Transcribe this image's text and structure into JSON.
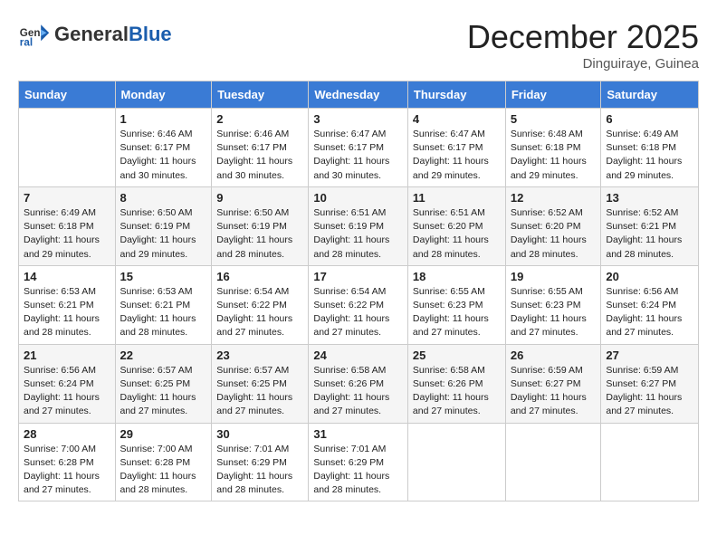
{
  "header": {
    "logo_general": "General",
    "logo_blue": "Blue",
    "month_title": "December 2025",
    "location": "Dinguiraye, Guinea"
  },
  "days_of_week": [
    "Sunday",
    "Monday",
    "Tuesday",
    "Wednesday",
    "Thursday",
    "Friday",
    "Saturday"
  ],
  "weeks": [
    [
      {
        "day": "",
        "sunrise": "",
        "sunset": "",
        "daylight": ""
      },
      {
        "day": "1",
        "sunrise": "Sunrise: 6:46 AM",
        "sunset": "Sunset: 6:17 PM",
        "daylight": "Daylight: 11 hours and 30 minutes."
      },
      {
        "day": "2",
        "sunrise": "Sunrise: 6:46 AM",
        "sunset": "Sunset: 6:17 PM",
        "daylight": "Daylight: 11 hours and 30 minutes."
      },
      {
        "day": "3",
        "sunrise": "Sunrise: 6:47 AM",
        "sunset": "Sunset: 6:17 PM",
        "daylight": "Daylight: 11 hours and 30 minutes."
      },
      {
        "day": "4",
        "sunrise": "Sunrise: 6:47 AM",
        "sunset": "Sunset: 6:17 PM",
        "daylight": "Daylight: 11 hours and 29 minutes."
      },
      {
        "day": "5",
        "sunrise": "Sunrise: 6:48 AM",
        "sunset": "Sunset: 6:18 PM",
        "daylight": "Daylight: 11 hours and 29 minutes."
      },
      {
        "day": "6",
        "sunrise": "Sunrise: 6:49 AM",
        "sunset": "Sunset: 6:18 PM",
        "daylight": "Daylight: 11 hours and 29 minutes."
      }
    ],
    [
      {
        "day": "7",
        "sunrise": "Sunrise: 6:49 AM",
        "sunset": "Sunset: 6:18 PM",
        "daylight": "Daylight: 11 hours and 29 minutes."
      },
      {
        "day": "8",
        "sunrise": "Sunrise: 6:50 AM",
        "sunset": "Sunset: 6:19 PM",
        "daylight": "Daylight: 11 hours and 29 minutes."
      },
      {
        "day": "9",
        "sunrise": "Sunrise: 6:50 AM",
        "sunset": "Sunset: 6:19 PM",
        "daylight": "Daylight: 11 hours and 28 minutes."
      },
      {
        "day": "10",
        "sunrise": "Sunrise: 6:51 AM",
        "sunset": "Sunset: 6:19 PM",
        "daylight": "Daylight: 11 hours and 28 minutes."
      },
      {
        "day": "11",
        "sunrise": "Sunrise: 6:51 AM",
        "sunset": "Sunset: 6:20 PM",
        "daylight": "Daylight: 11 hours and 28 minutes."
      },
      {
        "day": "12",
        "sunrise": "Sunrise: 6:52 AM",
        "sunset": "Sunset: 6:20 PM",
        "daylight": "Daylight: 11 hours and 28 minutes."
      },
      {
        "day": "13",
        "sunrise": "Sunrise: 6:52 AM",
        "sunset": "Sunset: 6:21 PM",
        "daylight": "Daylight: 11 hours and 28 minutes."
      }
    ],
    [
      {
        "day": "14",
        "sunrise": "Sunrise: 6:53 AM",
        "sunset": "Sunset: 6:21 PM",
        "daylight": "Daylight: 11 hours and 28 minutes."
      },
      {
        "day": "15",
        "sunrise": "Sunrise: 6:53 AM",
        "sunset": "Sunset: 6:21 PM",
        "daylight": "Daylight: 11 hours and 28 minutes."
      },
      {
        "day": "16",
        "sunrise": "Sunrise: 6:54 AM",
        "sunset": "Sunset: 6:22 PM",
        "daylight": "Daylight: 11 hours and 27 minutes."
      },
      {
        "day": "17",
        "sunrise": "Sunrise: 6:54 AM",
        "sunset": "Sunset: 6:22 PM",
        "daylight": "Daylight: 11 hours and 27 minutes."
      },
      {
        "day": "18",
        "sunrise": "Sunrise: 6:55 AM",
        "sunset": "Sunset: 6:23 PM",
        "daylight": "Daylight: 11 hours and 27 minutes."
      },
      {
        "day": "19",
        "sunrise": "Sunrise: 6:55 AM",
        "sunset": "Sunset: 6:23 PM",
        "daylight": "Daylight: 11 hours and 27 minutes."
      },
      {
        "day": "20",
        "sunrise": "Sunrise: 6:56 AM",
        "sunset": "Sunset: 6:24 PM",
        "daylight": "Daylight: 11 hours and 27 minutes."
      }
    ],
    [
      {
        "day": "21",
        "sunrise": "Sunrise: 6:56 AM",
        "sunset": "Sunset: 6:24 PM",
        "daylight": "Daylight: 11 hours and 27 minutes."
      },
      {
        "day": "22",
        "sunrise": "Sunrise: 6:57 AM",
        "sunset": "Sunset: 6:25 PM",
        "daylight": "Daylight: 11 hours and 27 minutes."
      },
      {
        "day": "23",
        "sunrise": "Sunrise: 6:57 AM",
        "sunset": "Sunset: 6:25 PM",
        "daylight": "Daylight: 11 hours and 27 minutes."
      },
      {
        "day": "24",
        "sunrise": "Sunrise: 6:58 AM",
        "sunset": "Sunset: 6:26 PM",
        "daylight": "Daylight: 11 hours and 27 minutes."
      },
      {
        "day": "25",
        "sunrise": "Sunrise: 6:58 AM",
        "sunset": "Sunset: 6:26 PM",
        "daylight": "Daylight: 11 hours and 27 minutes."
      },
      {
        "day": "26",
        "sunrise": "Sunrise: 6:59 AM",
        "sunset": "Sunset: 6:27 PM",
        "daylight": "Daylight: 11 hours and 27 minutes."
      },
      {
        "day": "27",
        "sunrise": "Sunrise: 6:59 AM",
        "sunset": "Sunset: 6:27 PM",
        "daylight": "Daylight: 11 hours and 27 minutes."
      }
    ],
    [
      {
        "day": "28",
        "sunrise": "Sunrise: 7:00 AM",
        "sunset": "Sunset: 6:28 PM",
        "daylight": "Daylight: 11 hours and 27 minutes."
      },
      {
        "day": "29",
        "sunrise": "Sunrise: 7:00 AM",
        "sunset": "Sunset: 6:28 PM",
        "daylight": "Daylight: 11 hours and 28 minutes."
      },
      {
        "day": "30",
        "sunrise": "Sunrise: 7:01 AM",
        "sunset": "Sunset: 6:29 PM",
        "daylight": "Daylight: 11 hours and 28 minutes."
      },
      {
        "day": "31",
        "sunrise": "Sunrise: 7:01 AM",
        "sunset": "Sunset: 6:29 PM",
        "daylight": "Daylight: 11 hours and 28 minutes."
      },
      {
        "day": "",
        "sunrise": "",
        "sunset": "",
        "daylight": ""
      },
      {
        "day": "",
        "sunrise": "",
        "sunset": "",
        "daylight": ""
      },
      {
        "day": "",
        "sunrise": "",
        "sunset": "",
        "daylight": ""
      }
    ]
  ]
}
